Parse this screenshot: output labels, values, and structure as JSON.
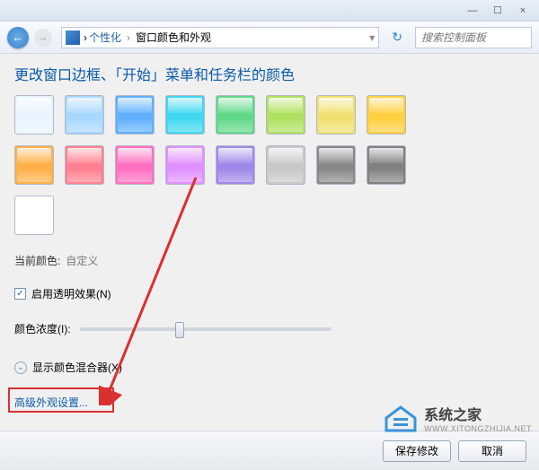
{
  "titlebar": {
    "min": "—",
    "max": "☐",
    "close": "×"
  },
  "nav": {
    "back_glyph": "←",
    "forward_glyph": "→",
    "refresh_glyph": "↻"
  },
  "breadcrumb": {
    "root": "个性化",
    "current": "窗口颜色和外观",
    "sep": "›"
  },
  "search": {
    "placeholder": "搜索控制面板"
  },
  "page_title": "更改窗口边框、「开始」菜单和任务栏的颜色",
  "swatches": [
    "#e8f4ff",
    "#a8d8ff",
    "#60b0ff",
    "#40d8f0",
    "#60d888",
    "#b0e060",
    "#f0e070",
    "#ffd040",
    "#ffb048",
    "#ff8090",
    "#ff70c0",
    "#e090ff",
    "#a088e8",
    "#c8c8c8",
    "#888888",
    "#808080",
    "#ffffff"
  ],
  "fields": {
    "current_color_label": "当前颜色:",
    "current_color_value": "自定义",
    "transparency_label": "启用透明效果(N)",
    "transparency_checked": "✓",
    "intensity_label": "颜色浓度(I):",
    "expander_label": "显示颜色混合器(X)",
    "expander_glyph": "⌄",
    "advanced_link": "高级外观设置..."
  },
  "footer": {
    "save": "保存修改",
    "cancel": "取消"
  },
  "watermark": {
    "brand": "系统之家",
    "sub": "WWW.XITONGZHIJIA.NET"
  }
}
